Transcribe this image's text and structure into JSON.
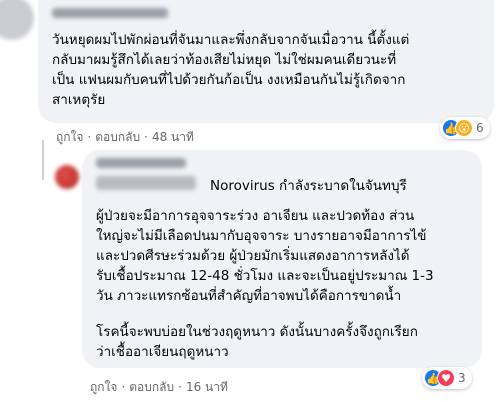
{
  "comment1": {
    "text_lines": [
      "วันหยุดผมไปพักผ่อนที่จันมาและพึ่งกลับจากจันเมื่อวาน นี้ตั้งแต่",
      "กลับมาผมรู้สึกได้เลยว่าท้องเสียไม่หยุด ไม่ใช่ผมคนเดียวนะที่",
      "เป็น แฟนผมกับคนที่ไปด้วยกันก้อเป็น งงเหมือนกันไม่รู้เกิดจาก",
      "สาเหตุรัย"
    ],
    "actions": {
      "like": "ถูกใจ",
      "reply": "ตอบกลับ",
      "time": "48 นาที"
    },
    "reactions": {
      "count": "6",
      "emoji": [
        "like-icon",
        "wow-icon"
      ]
    }
  },
  "reply": {
    "headline": "Norovirus กำลังระบาดในจันทบุรี",
    "para1_lines": [
      "ผู้ป่วยจะมีอาการอุจจาระร่วง อาเจียน และปวดท้อง ส่วน",
      "ใหญ่จะไม่มีเลือดปนมากับอุจจาระ บางรายอาจมีอาการไข้",
      "และปวดศีรษะร่วมด้วย ผู้ป่วยมักเริ่มแสดงอาการหลังได้",
      "รับเชื้อประมาณ 12-48 ชั่วโมง และจะเป็นอยู่ประมาณ 1-3",
      "วัน ภาวะแทรกซ้อนที่สำคัญที่อาจพบได้คือการขาดน้ำ"
    ],
    "para2_lines": [
      "โรคนี้จะพบบ่อยในช่วงฤดูหนาว ดังนั้นบางครั้งจึงถูกเรียก",
      "ว่าเชื้ออาเจียนฤดูหนาว"
    ],
    "actions": {
      "like": "ถูกใจ",
      "reply": "ตอบกลับ",
      "time": "16 นาที"
    },
    "reactions": {
      "count": "3",
      "emoji": [
        "like-icon",
        "love-icon"
      ]
    }
  },
  "colors": {
    "like": "#1877f2",
    "love": "#f33e58",
    "wow": "#f7b125",
    "bubble": "#f0f2f5",
    "meta": "#65676b"
  }
}
